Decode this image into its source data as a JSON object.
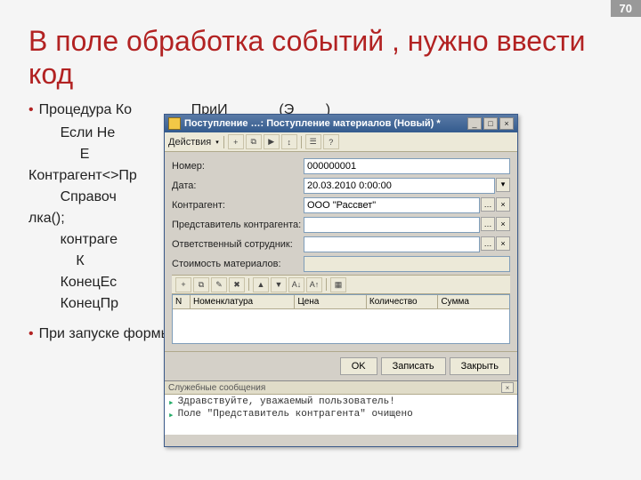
{
  "page_number": "70",
  "slide_title": "В поле обработка событий , нужно ввести код",
  "code": {
    "l1": "Процедура Ко               ПриИ             (Э        )",
    "l2": "        Если Не                                                               Тогда",
    "l3": "             Е",
    "l4": "Контрагент<>Пр                                                               Тогда",
    "l5": "",
    "l6": "        Справоч                                                                 а.Ссы",
    "l7": "лка();",
    "l8": "",
    "l9": "        контраге",
    "l10": "            К",
    "l11": "        КонецЕс",
    "l12": "        КонецПр",
    "l13": "При запуске формы в режиме 1С предриятие"
  },
  "window": {
    "title": "Поступление …: Поступление материалов (Новый) *",
    "actions_label": "Действия",
    "toolbar_dropdown": "▾",
    "fields": {
      "number": {
        "label": "Номер:",
        "value": "000000001"
      },
      "date": {
        "label": "Дата:",
        "value": "20.03.2010 0:00:00"
      },
      "counterparty": {
        "label": "Контрагент:",
        "value": "ООО \"Рассвет\""
      },
      "rep": {
        "label": "Представитель контрагента:",
        "value": ""
      },
      "responsible": {
        "label": "Ответственный сотрудник:",
        "value": ""
      },
      "cost": {
        "label": "Стоимость материалов:",
        "value": ""
      }
    },
    "grid_columns": [
      "N",
      "Номенклатура",
      "Цена",
      "Количество",
      "Сумма"
    ],
    "buttons": {
      "ok": "OK",
      "save": "Записать",
      "close": "Закрыть"
    },
    "messages": {
      "header": "Служебные сообщения",
      "lines": [
        "Здравствуйте, уважаемый пользователь!",
        "Поле \"Представитель контрагента\" очищено"
      ]
    },
    "win_btns": {
      "min": "_",
      "max": "□",
      "close": "×"
    },
    "field_btn_dots": "…",
    "field_btn_x": "×",
    "date_drop": "▾"
  }
}
